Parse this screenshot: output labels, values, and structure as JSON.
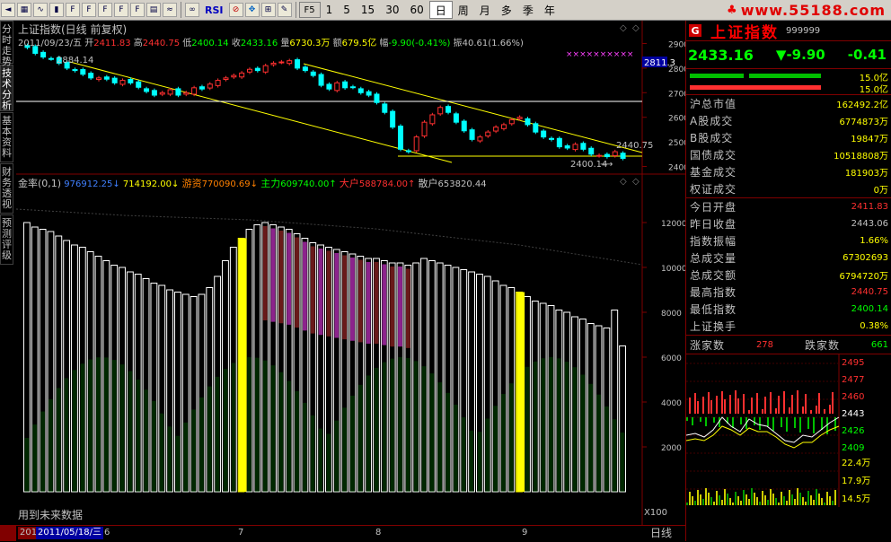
{
  "toolbar": {
    "icons": [
      "back-icon",
      "grid-icon",
      "line-chart-icon",
      "candle-icon",
      "f10-icon",
      "fo-icon",
      "f1-icon",
      "fz-icon",
      "fd-icon",
      "book-icon",
      "wave-icon"
    ],
    "rsi_label": "RSI",
    "f5_label": "F5",
    "periods": [
      "1",
      "5",
      "15",
      "30",
      "60"
    ],
    "day_periods": [
      "日",
      "周",
      "月",
      "多",
      "季",
      "年"
    ],
    "active_period": "日",
    "logo": "www.55188.com"
  },
  "sidetabs": [
    "分时走势",
    "技术分析",
    "基本资料",
    "财务透视",
    "预测评级"
  ],
  "chart": {
    "title": "上证指数(日线 前复权)",
    "info_date": "2011/09/23/五",
    "info_open_label": "开",
    "info_open": "2411.83",
    "info_high_label": "高",
    "info_high": "2440.75",
    "info_low_label": "低",
    "info_low": "2400.14",
    "info_close_label": "收",
    "info_close": "2433.16",
    "info_vol_label": "量",
    "info_vol": "6730.3万",
    "info_amount_label": "额",
    "info_amount": "679.5亿",
    "info_change_label": "幅",
    "info_change": "-9.90(-0.41%)",
    "info_amp_label": "振",
    "info_amp": "40.61(1.66%)",
    "high_marker": "2884.14",
    "last_price_marker": "2811.3",
    "right_tag_price": "2440.75",
    "low_marker": "2400.14",
    "price_axis": [
      "2900",
      "2800",
      "2700",
      "2600",
      "2500",
      "2400"
    ],
    "indicator_line": {
      "name": "金率(0,1)",
      "v1": "976912.25",
      "v2": "714192.00",
      "youzi_label": "游资",
      "youzi": "770090.69",
      "zhuli_label": "主力",
      "zhuli": "609740.00",
      "dahu_label": "大户",
      "dahu": "588784.00",
      "sanhu_label": "散户",
      "sanhu": "653820.44"
    },
    "indicator_axis": [
      "12000",
      "10000",
      "8000",
      "6000",
      "4000",
      "2000"
    ],
    "x100_label": "X100",
    "footer_note": "用到未来数据",
    "dates": [
      "2011",
      "2011/05/18/三",
      "6",
      "7",
      "8",
      "9"
    ],
    "period_label": "日线"
  },
  "chart_data": {
    "type": "candlestick",
    "title": "上证指数(日线 前复权)",
    "price_ylim": [
      2380,
      2920
    ],
    "indicator_ylim": [
      0,
      13000
    ],
    "price_series": [
      2884,
      2860,
      2845,
      2838,
      2820,
      2800,
      2790,
      2775,
      2760,
      2760,
      2755,
      2740,
      2750,
      2740,
      2722,
      2705,
      2690,
      2700,
      2712,
      2690,
      2700,
      2720,
      2715,
      2735,
      2750,
      2760,
      2770,
      2780,
      2795,
      2790,
      2810,
      2820,
      2825,
      2830,
      2800,
      2790,
      2770,
      2730,
      2715,
      2740,
      2720,
      2722,
      2700,
      2690,
      2660,
      2620,
      2560,
      2470,
      2460,
      2520,
      2580,
      2610,
      2640,
      2620,
      2580,
      2545,
      2510,
      2520,
      2540,
      2560,
      2570,
      2590,
      2600,
      2570,
      2540,
      2520,
      2510,
      2480,
      2475,
      2490,
      2470,
      2450,
      2445,
      2440,
      2460,
      2433
    ],
    "indicator_series": [
      12000,
      11800,
      11700,
      11600,
      11400,
      11200,
      11000,
      10900,
      10700,
      10500,
      10300,
      10100,
      10000,
      9800,
      9700,
      9500,
      9300,
      9200,
      9000,
      8900,
      8800,
      8700,
      8800,
      9100,
      9600,
      10300,
      10900,
      11300,
      11700,
      11900,
      12000,
      11900,
      11800,
      11700,
      11500,
      11300,
      11100,
      11000,
      10900,
      10800,
      10700,
      10600,
      10500,
      10400,
      10400,
      10300,
      10200,
      10200,
      10100,
      10200,
      10400,
      10300,
      10200,
      10100,
      10000,
      9900,
      9800,
      9700,
      9600,
      9400,
      9200,
      9100,
      8900,
      8700,
      8500,
      8400,
      8300,
      8100,
      8000,
      7800,
      7700,
      7500,
      7400,
      7300,
      8100,
      6500
    ]
  },
  "panel": {
    "g_label": "G",
    "name": "上证指数",
    "code": "999999",
    "price": "2433.16",
    "change": "▼-9.90",
    "change_pct": "-0.41",
    "bar1_val": "15.0亿",
    "bar2_val": "15.0亿",
    "rows1": [
      {
        "label": "沪总市值",
        "value": "162492.2亿"
      },
      {
        "label": "A股成交",
        "value": "6774873万"
      },
      {
        "label": "B股成交",
        "value": "19847万"
      },
      {
        "label": "国债成交",
        "value": "10518808万"
      },
      {
        "label": "基金成交",
        "value": "181903万"
      },
      {
        "label": "权证成交",
        "value": "0万"
      }
    ],
    "rows2": [
      {
        "label": "今日开盘",
        "value": "2411.83"
      },
      {
        "label": "昨日收盘",
        "value": "2443.06"
      },
      {
        "label": "指数振幅",
        "value": "1.66%"
      },
      {
        "label": "总成交量",
        "value": "67302693"
      },
      {
        "label": "总成交额",
        "value": "6794720万"
      },
      {
        "label": "最高指数",
        "value": "2440.75"
      },
      {
        "label": "最低指数",
        "value": "2400.14"
      },
      {
        "label": "上证换手",
        "value": "0.38%"
      }
    ],
    "up_label": "涨家数",
    "up_count": "278",
    "down_label": "跌家数",
    "down_count": "661",
    "mini_axis": [
      "2495",
      "2477",
      "2460",
      "2443",
      "2426",
      "2409",
      "22.4万",
      "17.9万",
      "14.5万"
    ],
    "colors": {
      "up": "#ff3030",
      "down": "#00ff00",
      "accent": "#ffff00",
      "bg": "#000000"
    }
  }
}
